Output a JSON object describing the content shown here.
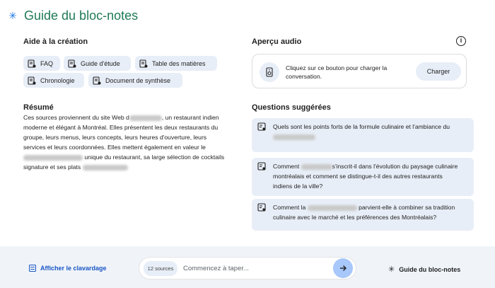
{
  "header": {
    "title": "Guide du bloc-notes"
  },
  "creation_aid": {
    "title": "Aide à la création",
    "chips": [
      {
        "label": "FAQ"
      },
      {
        "label": "Guide d'étude"
      },
      {
        "label": "Table des matières"
      },
      {
        "label": "Chronologie"
      },
      {
        "label": "Document de synthèse"
      }
    ]
  },
  "summary": {
    "title": "Résumé",
    "l1a": "Ces sources proviennent du site Web d",
    "l1b": ", un restaurant indien",
    "l2": "moderne et élégant à Montréal. Elles présentent les deux restaurants du",
    "l3": "groupe, leurs menus, leurs concepts, leurs heures d'ouverture, leurs",
    "l4": "services et leurs coordonnées. Elles mettent également en valeur le",
    "l5": "unique du restaurant, sa large sélection de cocktails",
    "l6": "signature et ses plats"
  },
  "audio": {
    "title": "Aperçu audio",
    "description": "Cliquez sur ce bouton pour charger la conversation.",
    "load_button": "Charger",
    "info_glyph": "i"
  },
  "questions": {
    "title": "Questions suggérées",
    "q1": "Quels sont les points forts de la formule culinaire et l'ambiance du",
    "q2_a": "Comment",
    "q2_b": "s'inscrit-il dans l'évolution du paysage culinaire",
    "q2_c": "montréalais et comment se distingue-t-il des autres restaurants",
    "q2_d": "indiens de la ville?",
    "q3_a": "Comment la",
    "q3_b": "parvient-elle à combiner sa tradition",
    "q3_c": "culinaire avec le marché et les préférences des Montréalais?"
  },
  "bottom": {
    "chat_toggle": "Afficher le clavardage",
    "sources_badge": "12 sources",
    "input_placeholder": "Commencez à taper...",
    "guide_button": "Guide du bloc-notes"
  },
  "colors": {
    "title_green": "#1f7a55",
    "accent_blue": "#1a73e8",
    "chip_bg": "#e8eef7",
    "send_button": "#a8c7fa",
    "bottom_bar": "#f0f4f9"
  },
  "icons": {
    "header": "sparkle-icon",
    "chip": "document-list-icon",
    "speaker": "speaker-icon",
    "question": "chat-suggestion-icon",
    "chat_toggle": "chat-list-icon",
    "send": "arrow-right-icon",
    "guide": "sparkle-icon"
  }
}
